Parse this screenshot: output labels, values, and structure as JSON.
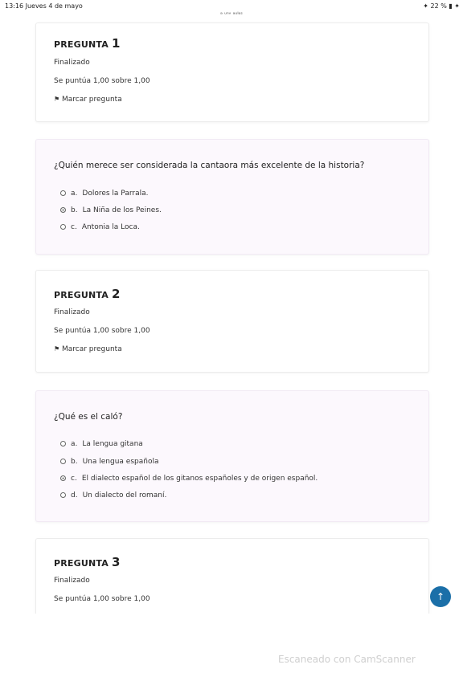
{
  "status_bar": {
    "time_date": "13:16 Jueves 4 de mayo",
    "url": "ᵃ ᵘⁿᵛ ᵃᵘˡᵃˢ",
    "right": "✦ 22 % ▮ ✦"
  },
  "questions": [
    {
      "label": "PREGUNTA",
      "number": "1",
      "status": "Finalizado",
      "score": "Se puntúa 1,00 sobre 1,00",
      "flag": "Marcar pregunta",
      "text": "¿Quién merece ser considerada la cantaora más excelente de la historia?",
      "options": [
        {
          "letter": "a.",
          "text": "Dolores la Parrala.",
          "checked": false
        },
        {
          "letter": "b.",
          "text": "La Niña de los Peines.",
          "checked": true
        },
        {
          "letter": "c.",
          "text": "Antonia la Loca.",
          "checked": false
        }
      ]
    },
    {
      "label": "PREGUNTA",
      "number": "2",
      "status": "Finalizado",
      "score": "Se puntúa 1,00 sobre 1,00",
      "flag": "Marcar pregunta",
      "text": "¿Qué es el caló?",
      "options": [
        {
          "letter": "a.",
          "text": "La lengua gitana",
          "checked": false
        },
        {
          "letter": "b.",
          "text": "Una lengua española",
          "checked": false
        },
        {
          "letter": "c.",
          "text": "El dialecto español de los gitanos españoles y de origen español.",
          "checked": true
        },
        {
          "letter": "d.",
          "text": "Un dialecto del romaní.",
          "checked": false
        }
      ]
    },
    {
      "label": "PREGUNTA",
      "number": "3",
      "status": "Finalizado",
      "score": "Se puntúa 1,00 sobre 1,00"
    }
  ],
  "fab_icon": "arrow-up-icon",
  "watermark": "Escaneado con CamScanner"
}
